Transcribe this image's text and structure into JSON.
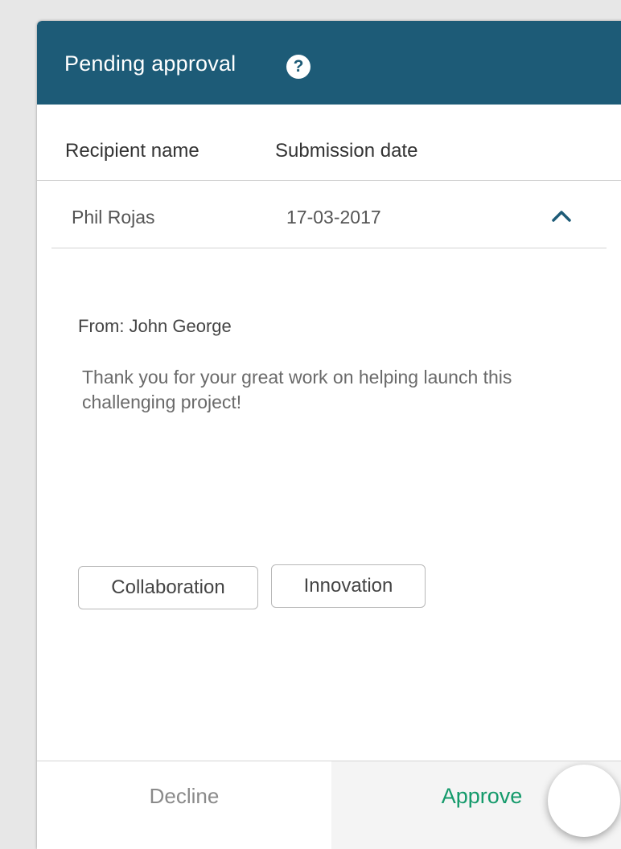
{
  "header": {
    "title": "Pending approval",
    "help_icon": "?"
  },
  "columns": {
    "recipient": "Recipient name",
    "date": "Submission date"
  },
  "row": {
    "name": "Phil Rojas",
    "date": "17-03-2017",
    "expand_icon": "chevron-up-icon"
  },
  "detail": {
    "from": "From: John George",
    "message": "Thank you for your great work on helping launch this challenging project!",
    "tags": [
      "Collaboration",
      "Innovation"
    ]
  },
  "actions": {
    "decline": "Decline",
    "approve": "Approve"
  },
  "colors": {
    "header_bg": "#1d5b77",
    "approve_text": "#149a6b",
    "decline_text": "#8a8a8a"
  }
}
